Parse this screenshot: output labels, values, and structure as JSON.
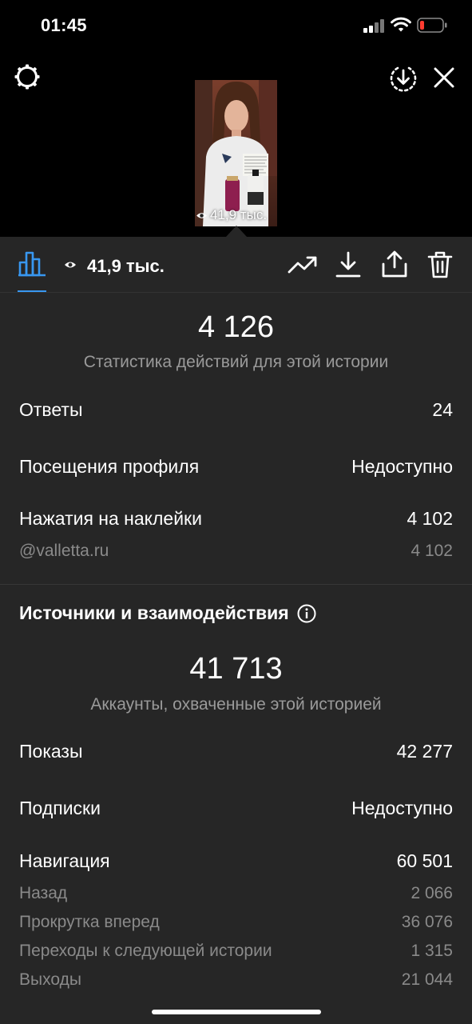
{
  "status_bar": {
    "time": "01:45"
  },
  "story": {
    "thumb_views": "41,9 тыс."
  },
  "toolbar": {
    "views": "41,9 тыс."
  },
  "interactions": {
    "total": "4 126",
    "caption": "Статистика действий для этой истории",
    "rows": [
      {
        "label": "Ответы",
        "value": "24"
      },
      {
        "label": "Посещения профиля",
        "value": "Недоступно"
      },
      {
        "label": "Нажатия на наклейки",
        "value": "4 102"
      }
    ],
    "sticker_sub": {
      "label": "@valletta.ru",
      "value": "4 102"
    }
  },
  "discovery": {
    "title": "Источники и взаимодействия",
    "total": "41 713",
    "caption": "Аккаунты, охваченные этой историей",
    "rows": [
      {
        "label": "Показы",
        "value": "42 277"
      },
      {
        "label": "Подписки",
        "value": "Недоступно"
      },
      {
        "label": "Навигация",
        "value": "60 501"
      }
    ],
    "navigation_sub": [
      {
        "label": "Назад",
        "value": "2 066"
      },
      {
        "label": "Прокрутка вперед",
        "value": "36 076"
      },
      {
        "label": "Переходы к следующей истории",
        "value": "1 315"
      },
      {
        "label": "Выходы",
        "value": "21 044"
      }
    ]
  },
  "colors": {
    "accent": "#3897f0",
    "panel": "#262626",
    "muted": "#9a9a9a",
    "battery_low": "#ff3b30"
  },
  "icons": [
    "gear-icon",
    "download-circle-icon",
    "close-icon",
    "bar-chart-icon",
    "eye-icon",
    "trend-icon",
    "download-icon",
    "share-icon",
    "trash-icon",
    "info-icon"
  ]
}
